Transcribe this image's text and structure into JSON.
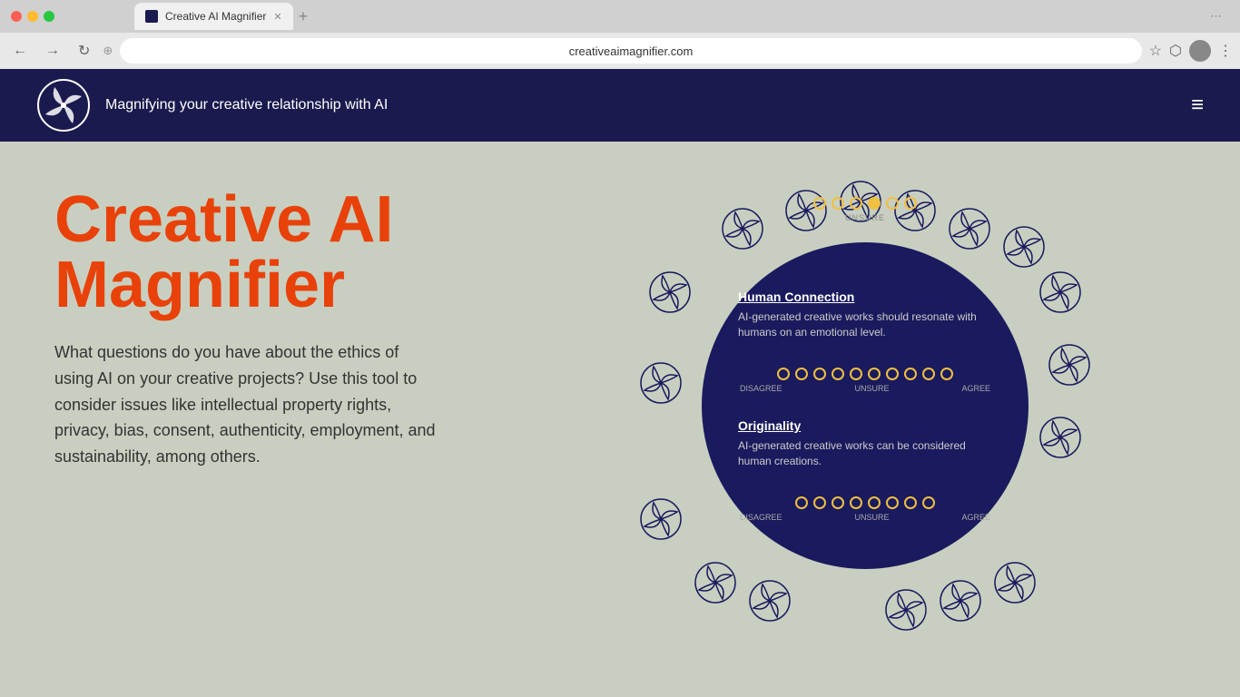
{
  "browser": {
    "tab_title": "Creative AI Magnifier",
    "url": "creativeaimagnifier.com",
    "new_tab_symbol": "+",
    "back_symbol": "←",
    "forward_symbol": "→",
    "refresh_symbol": "↻"
  },
  "header": {
    "tagline": "Magnifying your creative relationship with AI",
    "hamburger": "≡"
  },
  "hero": {
    "title_line1": "Creative AI",
    "title_line2": "Magnifier",
    "description": "What questions do you have about the ethics of using AI on your creative projects? Use this tool to consider issues like intellectual property rights, privacy, bias, consent, authenticity, employment, and sustainability, among others."
  },
  "widget": {
    "top_label": "UNSURE",
    "question1": {
      "title": "Human Connection",
      "text": "AI-generated creative works should resonate with humans on an emotional level.",
      "labels": {
        "left": "DISAGREE",
        "center": "UNSURE",
        "right": "AGREE"
      }
    },
    "question2": {
      "title": "Originality",
      "text": "AI-generated creative works can be considered human creations.",
      "labels": {
        "left": "DISAGREE",
        "center": "UNSURE",
        "right": "AGREE"
      }
    }
  }
}
